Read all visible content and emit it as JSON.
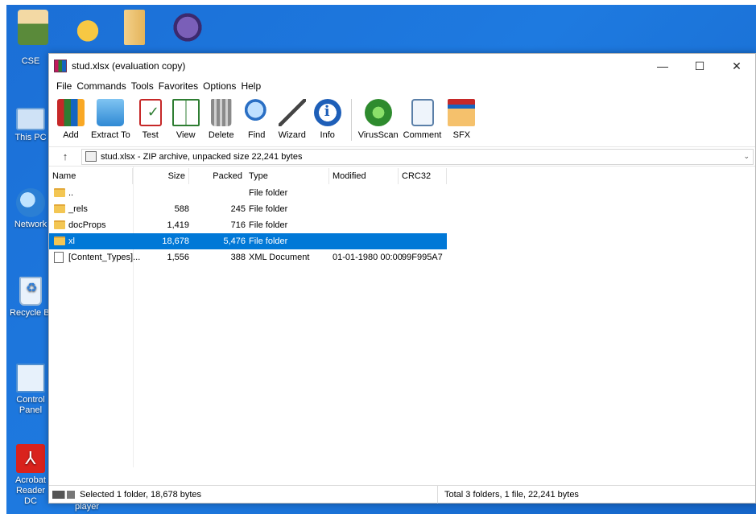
{
  "desktop": {
    "icons": [
      {
        "label": "CSE"
      },
      {
        "label": "This PC"
      },
      {
        "label": "Network"
      },
      {
        "label": "Recycle Bi"
      },
      {
        "label": "Control Panel"
      },
      {
        "label": "Acrobat Reader DC"
      }
    ],
    "partial_label": "player"
  },
  "window": {
    "title": "stud.xlsx (evaluation copy)",
    "controls": {
      "minimize": "—",
      "maximize": "☐",
      "close": "✕"
    }
  },
  "menu": [
    "File",
    "Commands",
    "Tools",
    "Favorites",
    "Options",
    "Help"
  ],
  "toolbar": [
    {
      "label": "Add",
      "icon": "add-icon"
    },
    {
      "label": "Extract To",
      "icon": "extract-icon"
    },
    {
      "label": "Test",
      "icon": "test-icon"
    },
    {
      "label": "View",
      "icon": "view-icon"
    },
    {
      "label": "Delete",
      "icon": "delete-icon"
    },
    {
      "label": "Find",
      "icon": "find-icon"
    },
    {
      "label": "Wizard",
      "icon": "wizard-icon"
    },
    {
      "label": "Info",
      "icon": "info-icon"
    },
    {
      "label": "VirusScan",
      "icon": "virusscan-icon"
    },
    {
      "label": "Comment",
      "icon": "comment-icon"
    },
    {
      "label": "SFX",
      "icon": "sfx-icon"
    }
  ],
  "address": {
    "up": "↑",
    "value": "stud.xlsx - ZIP archive, unpacked size 22,241 bytes"
  },
  "columns": [
    "Name",
    "Size",
    "Packed",
    "Type",
    "Modified",
    "CRC32"
  ],
  "rows": [
    {
      "name": "..",
      "size": "",
      "packed": "",
      "type": "File folder",
      "modified": "",
      "crc": "",
      "icon": "folder",
      "selected": false
    },
    {
      "name": "_rels",
      "size": "588",
      "packed": "245",
      "type": "File folder",
      "modified": "",
      "crc": "",
      "icon": "folder",
      "selected": false
    },
    {
      "name": "docProps",
      "size": "1,419",
      "packed": "716",
      "type": "File folder",
      "modified": "",
      "crc": "",
      "icon": "folder",
      "selected": false
    },
    {
      "name": "xl",
      "size": "18,678",
      "packed": "5,476",
      "type": "File folder",
      "modified": "",
      "crc": "",
      "icon": "folder",
      "selected": true
    },
    {
      "name": "[Content_Types]...",
      "size": "1,556",
      "packed": "388",
      "type": "XML Document",
      "modified": "01-01-1980 00:00",
      "crc": "99F995A7",
      "icon": "document",
      "selected": false
    }
  ],
  "status": {
    "left": "Selected 1 folder, 18,678 bytes",
    "right": "Total 3 folders, 1 file, 22,241 bytes"
  },
  "colors": {
    "selection": "#0078d7",
    "desktop": "#1e7ae0"
  }
}
